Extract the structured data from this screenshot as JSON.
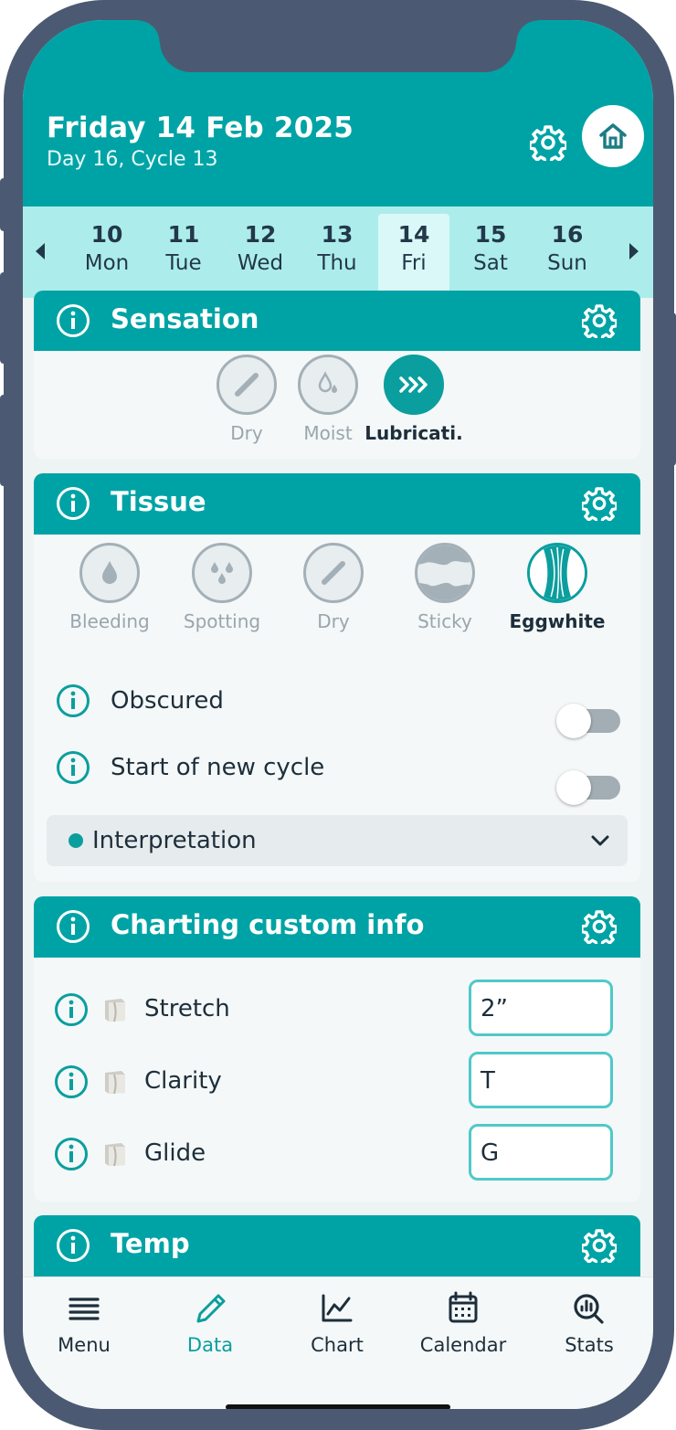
{
  "header": {
    "date": "Friday 14 Feb 2025",
    "subtitle": "Day 16, Cycle 13"
  },
  "days": [
    {
      "num": "10",
      "wd": "Mon",
      "selected": false
    },
    {
      "num": "11",
      "wd": "Tue",
      "selected": false
    },
    {
      "num": "12",
      "wd": "Wed",
      "selected": false
    },
    {
      "num": "13",
      "wd": "Thu",
      "selected": false
    },
    {
      "num": "14",
      "wd": "Fri",
      "selected": true
    },
    {
      "num": "15",
      "wd": "Sat",
      "selected": false
    },
    {
      "num": "16",
      "wd": "Sun",
      "selected": false
    }
  ],
  "sensation": {
    "title": "Sensation",
    "options": [
      {
        "label": "Dry",
        "icon": "slash-icon",
        "selected": false
      },
      {
        "label": "Moist",
        "icon": "droplet-icon",
        "selected": false
      },
      {
        "label": "Lubricati.",
        "icon": "chevrons-icon",
        "selected": true
      }
    ]
  },
  "tissue": {
    "title": "Tissue",
    "options": [
      {
        "label": "Bleeding",
        "icon": "drop-icon",
        "selected": false
      },
      {
        "label": "Spotting",
        "icon": "drops-icon",
        "selected": false
      },
      {
        "label": "Dry",
        "icon": "slash-icon",
        "selected": false
      },
      {
        "label": "Sticky",
        "icon": "sticky-icon",
        "selected": false
      },
      {
        "label": "Eggwhite",
        "icon": "eggwhite-icon",
        "selected": true
      }
    ],
    "obscured_label": "Obscured",
    "obscured_on": false,
    "new_cycle_label": "Start of new cycle",
    "new_cycle_on": false,
    "interpretation_label": "Interpretation"
  },
  "custom": {
    "title": "Charting custom info",
    "rows": [
      {
        "label": "Stretch",
        "value": "2”"
      },
      {
        "label": "Clarity",
        "value": "T"
      },
      {
        "label": "Glide",
        "value": "G"
      }
    ]
  },
  "temp": {
    "title": "Temp"
  },
  "tabs": [
    {
      "label": "Menu",
      "icon": "menu-icon",
      "active": false
    },
    {
      "label": "Data",
      "icon": "pencil-icon",
      "active": true
    },
    {
      "label": "Chart",
      "icon": "chart-icon",
      "active": false
    },
    {
      "label": "Calendar",
      "icon": "calendar-icon",
      "active": false
    },
    {
      "label": "Stats",
      "icon": "stats-icon",
      "active": false
    }
  ],
  "colors": {
    "primary": "#00a3a5",
    "strip": "#acedeb",
    "text": "#1d2e3b",
    "muted": "#9aa5ad",
    "frame": "#4b5a72"
  }
}
